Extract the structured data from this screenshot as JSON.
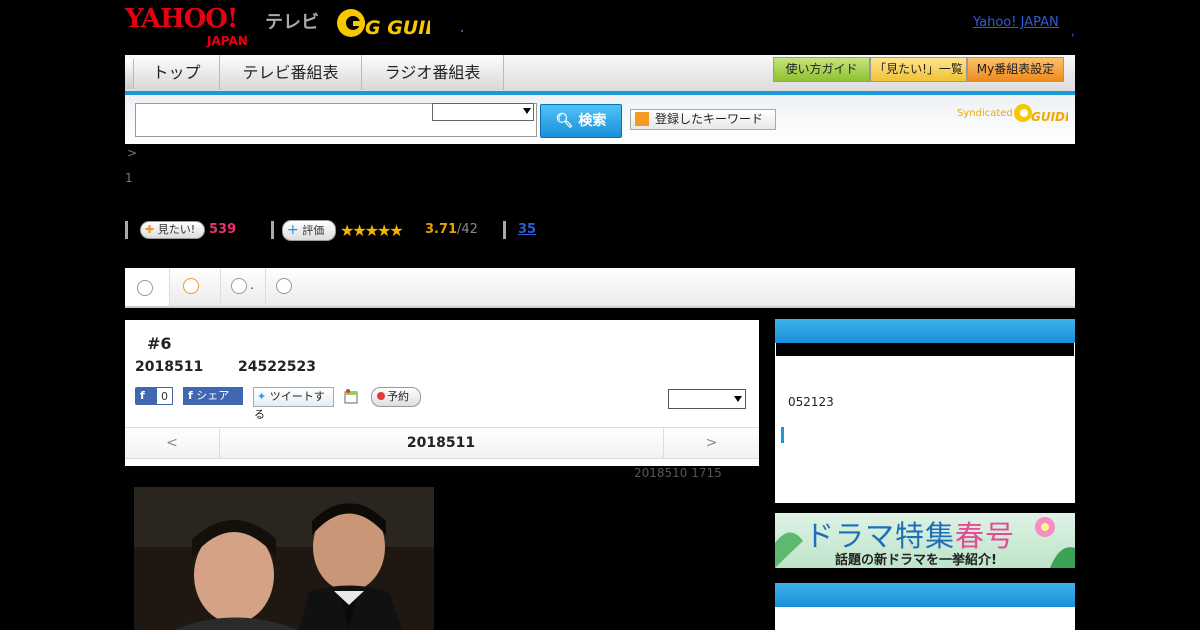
{
  "header": {
    "yahoo_logo": "YAHOO!",
    "yahoo_logo_sub": "JAPAN",
    "tv_logo": "テレビ",
    "gguide_logo": "G GUIDE",
    "yahoo_japan_link": "Yahoo! JAPAN"
  },
  "nav": {
    "tabs": [
      "トップ",
      "テレビ番組表",
      "ラジオ番組表"
    ],
    "buttons": [
      {
        "label": "使い方ガイド",
        "color": "#9ccc3c"
      },
      {
        "label": "「見たい!」一覧",
        "color": "#f7c948"
      },
      {
        "label": "My番組表設定",
        "color": "#f39a23"
      }
    ]
  },
  "search": {
    "input_value": "",
    "search_button": "検索",
    "keyword_button": "登録したキーワード",
    "syndicated": "Syndicated",
    "syndicated_logo": "GUIDE"
  },
  "breadcrumb": {
    "line1": ">",
    "line2": "1"
  },
  "stats": {
    "want_label": "見たい!",
    "want_count": "539",
    "rate_label": "評価",
    "stars": "★★★★★",
    "rating": "3.71",
    "rating_count": "/42",
    "link_count": "35"
  },
  "tabs": {
    "tab2_text": "."
  },
  "program": {
    "episode": "#6",
    "date": "2018511",
    "time": "24522523",
    "fb_like": "0",
    "fb_share": "シェア",
    "tweet": "ツイートする",
    "reserve": "予約",
    "pager_prev": "<",
    "pager_date": "2018511",
    "pager_next": ">",
    "updated": "2018510  1715"
  },
  "right": {
    "box1_text": "052123",
    "banner_title_main": "ドラマ特集",
    "banner_title_accent": "春号",
    "banner_sub": "話題の新ドラマを一挙紹介!"
  },
  "colors": {
    "accent_blue": "#1a98d8",
    "want_pink": "#e8336d",
    "star_gold": "#f3b600",
    "link_blue": "#2e5bd6"
  }
}
